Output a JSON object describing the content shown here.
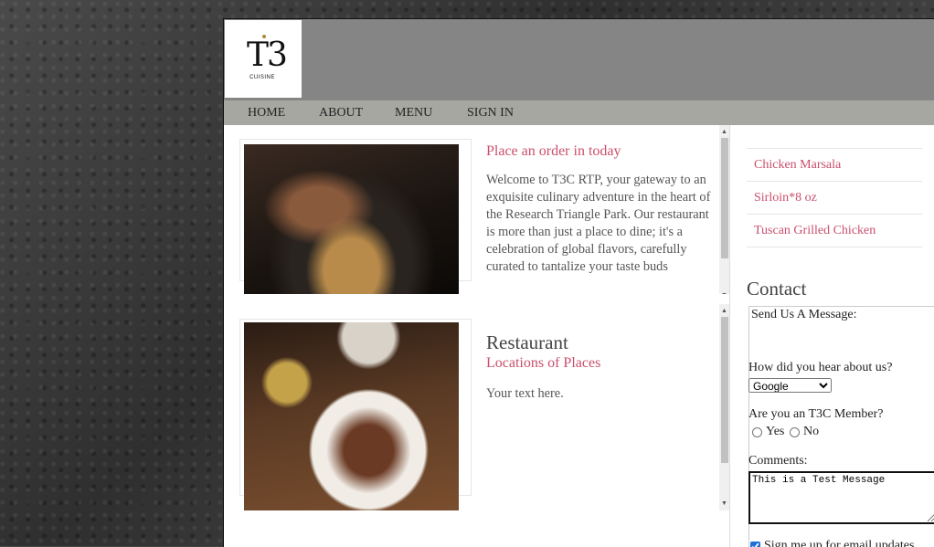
{
  "logo": {
    "mark": "T3",
    "wordmark": "CUISINE"
  },
  "nav": {
    "items": [
      "HOME",
      "ABOUT",
      "MENU",
      "SIGN IN"
    ]
  },
  "feed": {
    "post1": {
      "title": "Place an order in today",
      "body": "Welcome to T3C RTP, your gateway to an exquisite culinary adventure in the heart of the Research Triangle Park. Our restaurant is more than just a place to dine; it's a celebration of global flavors, carefully curated to tantalize your taste buds"
    },
    "post2": {
      "heading": "Restaurant",
      "subtitle": "Locations of Places",
      "body": "Your text here."
    }
  },
  "sidebar": {
    "menu_items": [
      "Chicken Marsala",
      "Sirloin*8 oz",
      "Tuscan Grilled Chicken"
    ]
  },
  "contact": {
    "title": "Contact",
    "legend": "Send Us A Message:",
    "heard_label": "How did you hear about us?",
    "heard_value": "Google",
    "member_label": "Are you an T3C Member?",
    "yes_label": "Yes",
    "no_label": "No",
    "comments_label": "Comments:",
    "comments_value": "This is a Test Message",
    "signup_label": "Sign me up for email updates"
  },
  "colors": {
    "accent": "#c94f6d",
    "header": "#858585",
    "nav": "#a7a7a2"
  }
}
